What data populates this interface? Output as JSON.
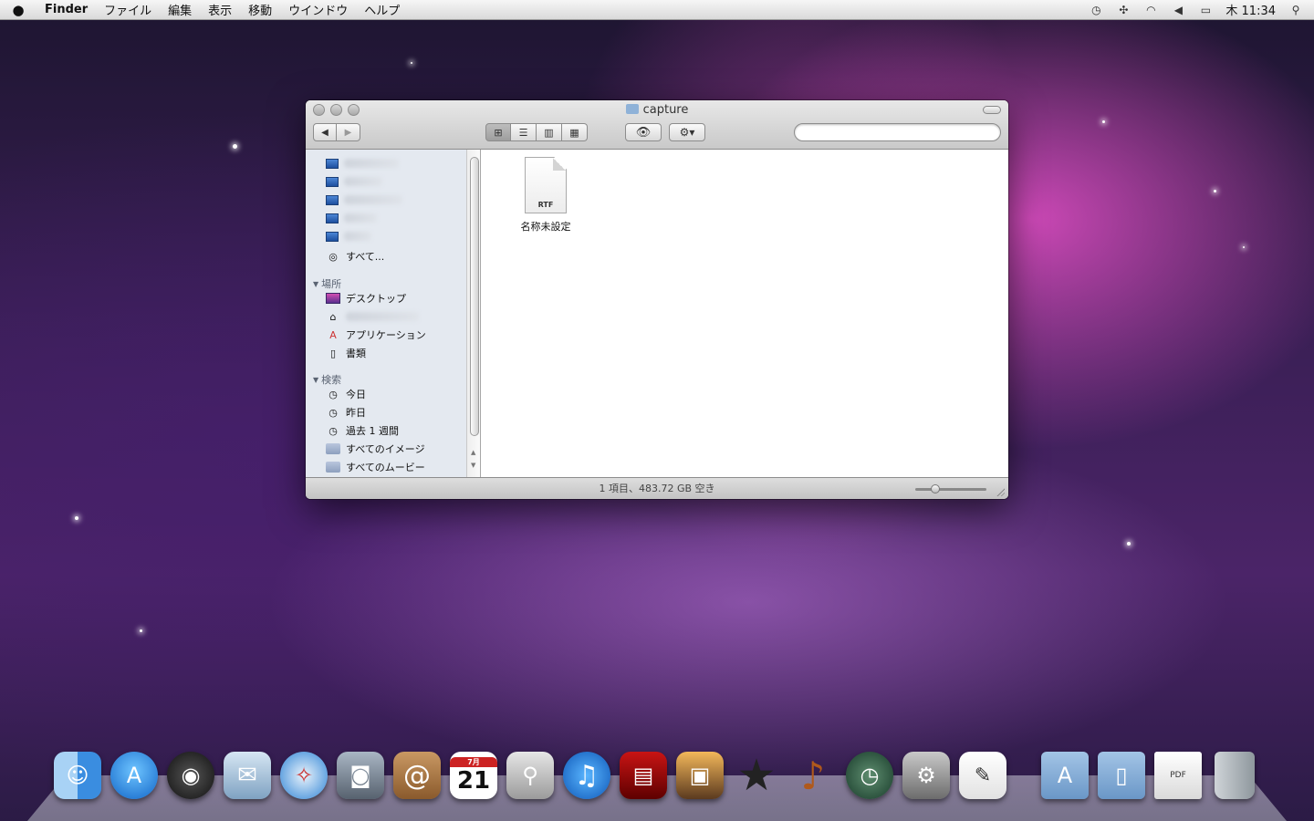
{
  "menubar": {
    "app": "Finder",
    "menus": [
      "ファイル",
      "編集",
      "表示",
      "移動",
      "ウインドウ",
      "ヘルプ"
    ],
    "clock": "木 11:34"
  },
  "window": {
    "title": "capture",
    "sidebar": {
      "all_label": "すべて...",
      "places_header": "場所",
      "places": [
        "デスクトップ",
        "",
        "アプリケーション",
        "書類"
      ],
      "search_header": "検索",
      "searches": [
        "今日",
        "昨日",
        "過去 1 週間",
        "すべてのイメージ",
        "すべてのムービー"
      ]
    },
    "file": {
      "name": "名称未設定",
      "ext": "RTF"
    },
    "status": "1 項目、483.72 GB 空き",
    "icon_size_slider": 0.25
  },
  "dock": {
    "apps": [
      "finder-icon",
      "app-store-icon",
      "dashboard-icon",
      "mail-icon",
      "safari-icon",
      "facetime-icon",
      "address-book-icon",
      "ical-icon",
      "preview-icon",
      "itunes-icon",
      "photo-booth-icon",
      "iphoto-icon",
      "imovie-icon",
      "garageband-icon",
      "time-machine-icon",
      "system-preferences-icon",
      "textedit-icon"
    ],
    "ical_day": "21",
    "ical_month": "7月",
    "stacks": [
      "applications-folder-icon",
      "documents-folder-icon",
      "pdf-file-icon",
      "trash-icon"
    ],
    "pdf_label": "PDF"
  }
}
